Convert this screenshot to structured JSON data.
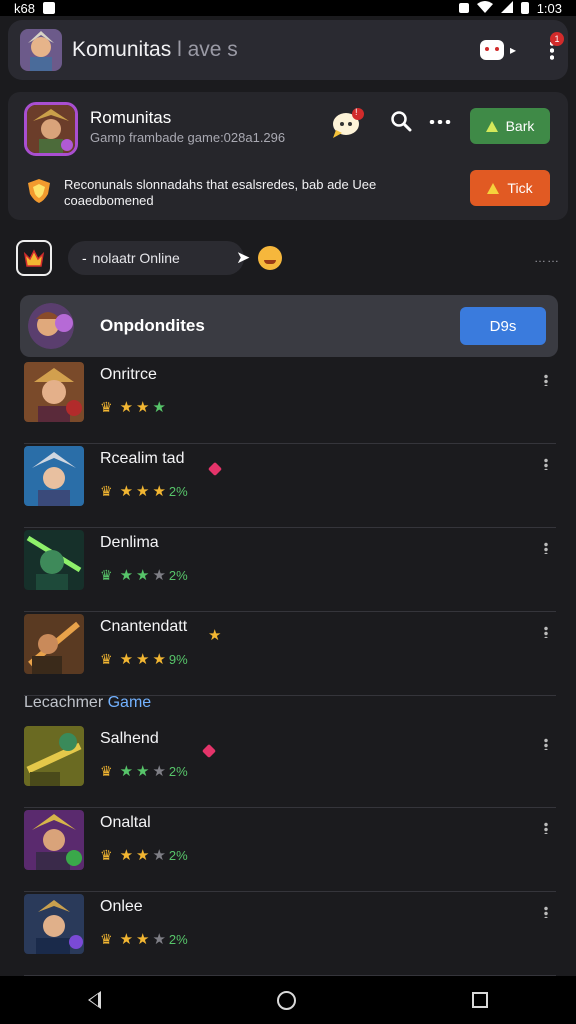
{
  "status_bar": {
    "left_text": "k68",
    "time": "1:03"
  },
  "app_bar": {
    "title_main": "Komunitas",
    "title_faded": "l ave s",
    "notification_count": "1"
  },
  "game_card": {
    "title": "Romunitas",
    "subtitle": "Gamp frambade game:028a1.296",
    "bubble_badge": "!",
    "primary_button": "Bark",
    "secondary_button": "Tick",
    "notice": "Reconunals slonnadahs that esalsredes, bab ade Uee coaedbomened"
  },
  "search": {
    "value": "nolaatr Online",
    "more_label": "……"
  },
  "featured": {
    "title": "Onpdondites",
    "button_label": "D9s"
  },
  "section_label": {
    "prefix": "Lecachmer",
    "accent": "Game"
  },
  "games": [
    {
      "name": "Onritrce",
      "rating": "",
      "filled_stars": 3
    },
    {
      "name": "Rcealim tad",
      "rating": "2%",
      "filled_stars": 3
    },
    {
      "name": "Denlima",
      "rating": "2%",
      "filled_stars": 2
    },
    {
      "name": "Cnantendatt",
      "rating": "9%",
      "filled_stars": 3
    },
    {
      "name": "Salhend",
      "rating": "2%",
      "filled_stars": 2
    },
    {
      "name": "Onaltal",
      "rating": "2%",
      "filled_stars": 2
    },
    {
      "name": "Onlee",
      "rating": "2%",
      "filled_stars": 2
    }
  ],
  "colors": {
    "background": "#1b1b1e",
    "accent_green": "#3f8a47",
    "accent_orange": "#e15a23",
    "accent_blue": "#3a7bdd",
    "star_green": "#57c56a",
    "star_gold": "#f2b632",
    "badge_red": "#d22b2b"
  },
  "icons": [
    "gamepad-icon",
    "more-vert-icon",
    "chat-bubble-icon",
    "search-icon",
    "more-horiz-icon",
    "crown-icon",
    "back-icon",
    "home-icon",
    "recents-icon"
  ]
}
